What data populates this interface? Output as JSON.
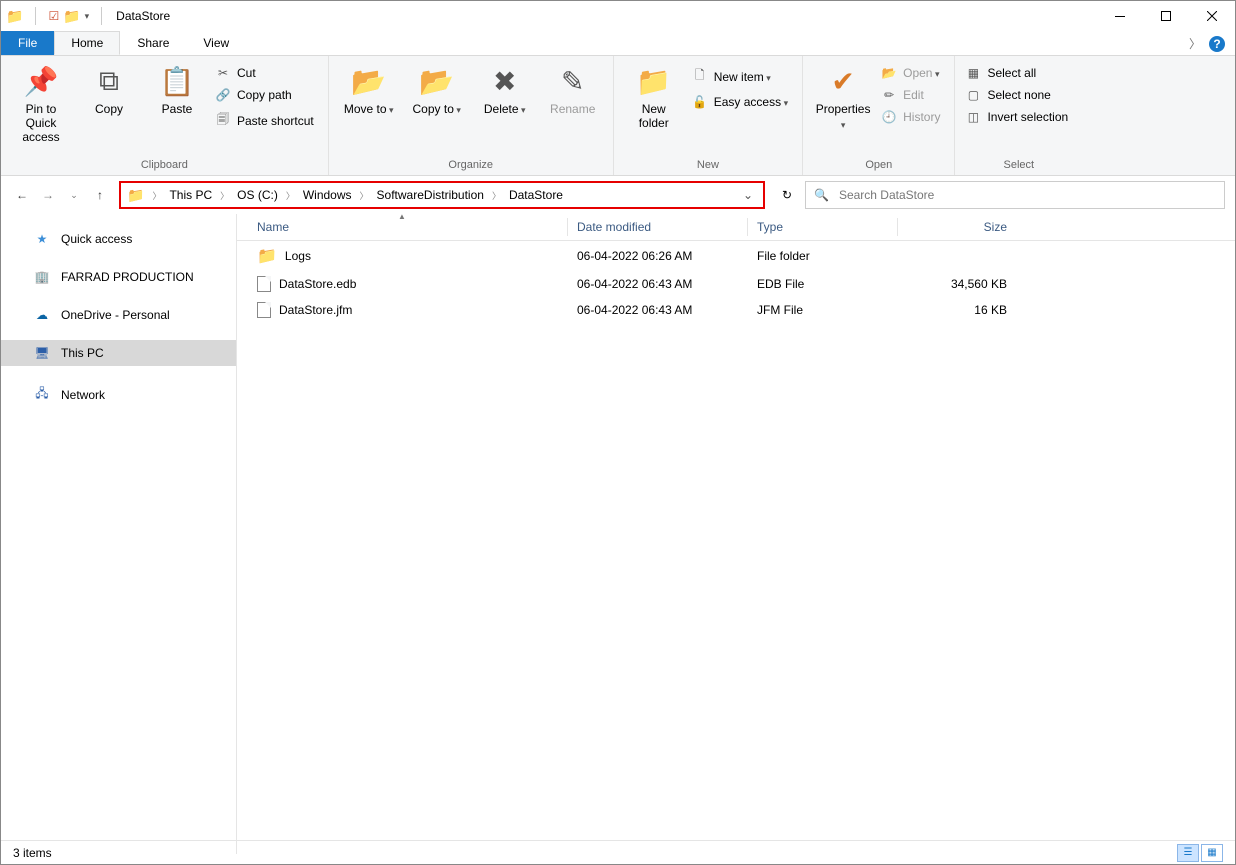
{
  "window": {
    "title": "DataStore"
  },
  "tabs": {
    "file": "File",
    "home": "Home",
    "share": "Share",
    "view": "View"
  },
  "ribbon": {
    "clipboard": {
      "label": "Clipboard",
      "pin": "Pin to Quick access",
      "copy": "Copy",
      "paste": "Paste",
      "cut": "Cut",
      "copy_path": "Copy path",
      "paste_shortcut": "Paste shortcut"
    },
    "organize": {
      "label": "Organize",
      "move_to": "Move to",
      "copy_to": "Copy to",
      "delete": "Delete",
      "rename": "Rename"
    },
    "new": {
      "label": "New",
      "new_folder": "New folder",
      "new_item": "New item",
      "easy_access": "Easy access"
    },
    "open": {
      "label": "Open",
      "properties": "Properties",
      "open": "Open",
      "edit": "Edit",
      "history": "History"
    },
    "select": {
      "label": "Select",
      "select_all": "Select all",
      "select_none": "Select none",
      "invert": "Invert selection"
    }
  },
  "breadcrumbs": [
    "This PC",
    "OS (C:)",
    "Windows",
    "SoftwareDistribution",
    "DataStore"
  ],
  "search": {
    "placeholder": "Search DataStore"
  },
  "sidebar": {
    "quick_access": "Quick access",
    "farrad": "FARRAD PRODUCTION",
    "onedrive": "OneDrive - Personal",
    "this_pc": "This PC",
    "network": "Network"
  },
  "columns": {
    "name": "Name",
    "date": "Date modified",
    "type": "Type",
    "size": "Size"
  },
  "files": [
    {
      "icon": "folder",
      "name": "Logs",
      "date": "06-04-2022 06:26 AM",
      "type": "File folder",
      "size": ""
    },
    {
      "icon": "file",
      "name": "DataStore.edb",
      "date": "06-04-2022 06:43 AM",
      "type": "EDB File",
      "size": "34,560 KB"
    },
    {
      "icon": "file",
      "name": "DataStore.jfm",
      "date": "06-04-2022 06:43 AM",
      "type": "JFM File",
      "size": "16 KB"
    }
  ],
  "status": {
    "items": "3 items"
  }
}
